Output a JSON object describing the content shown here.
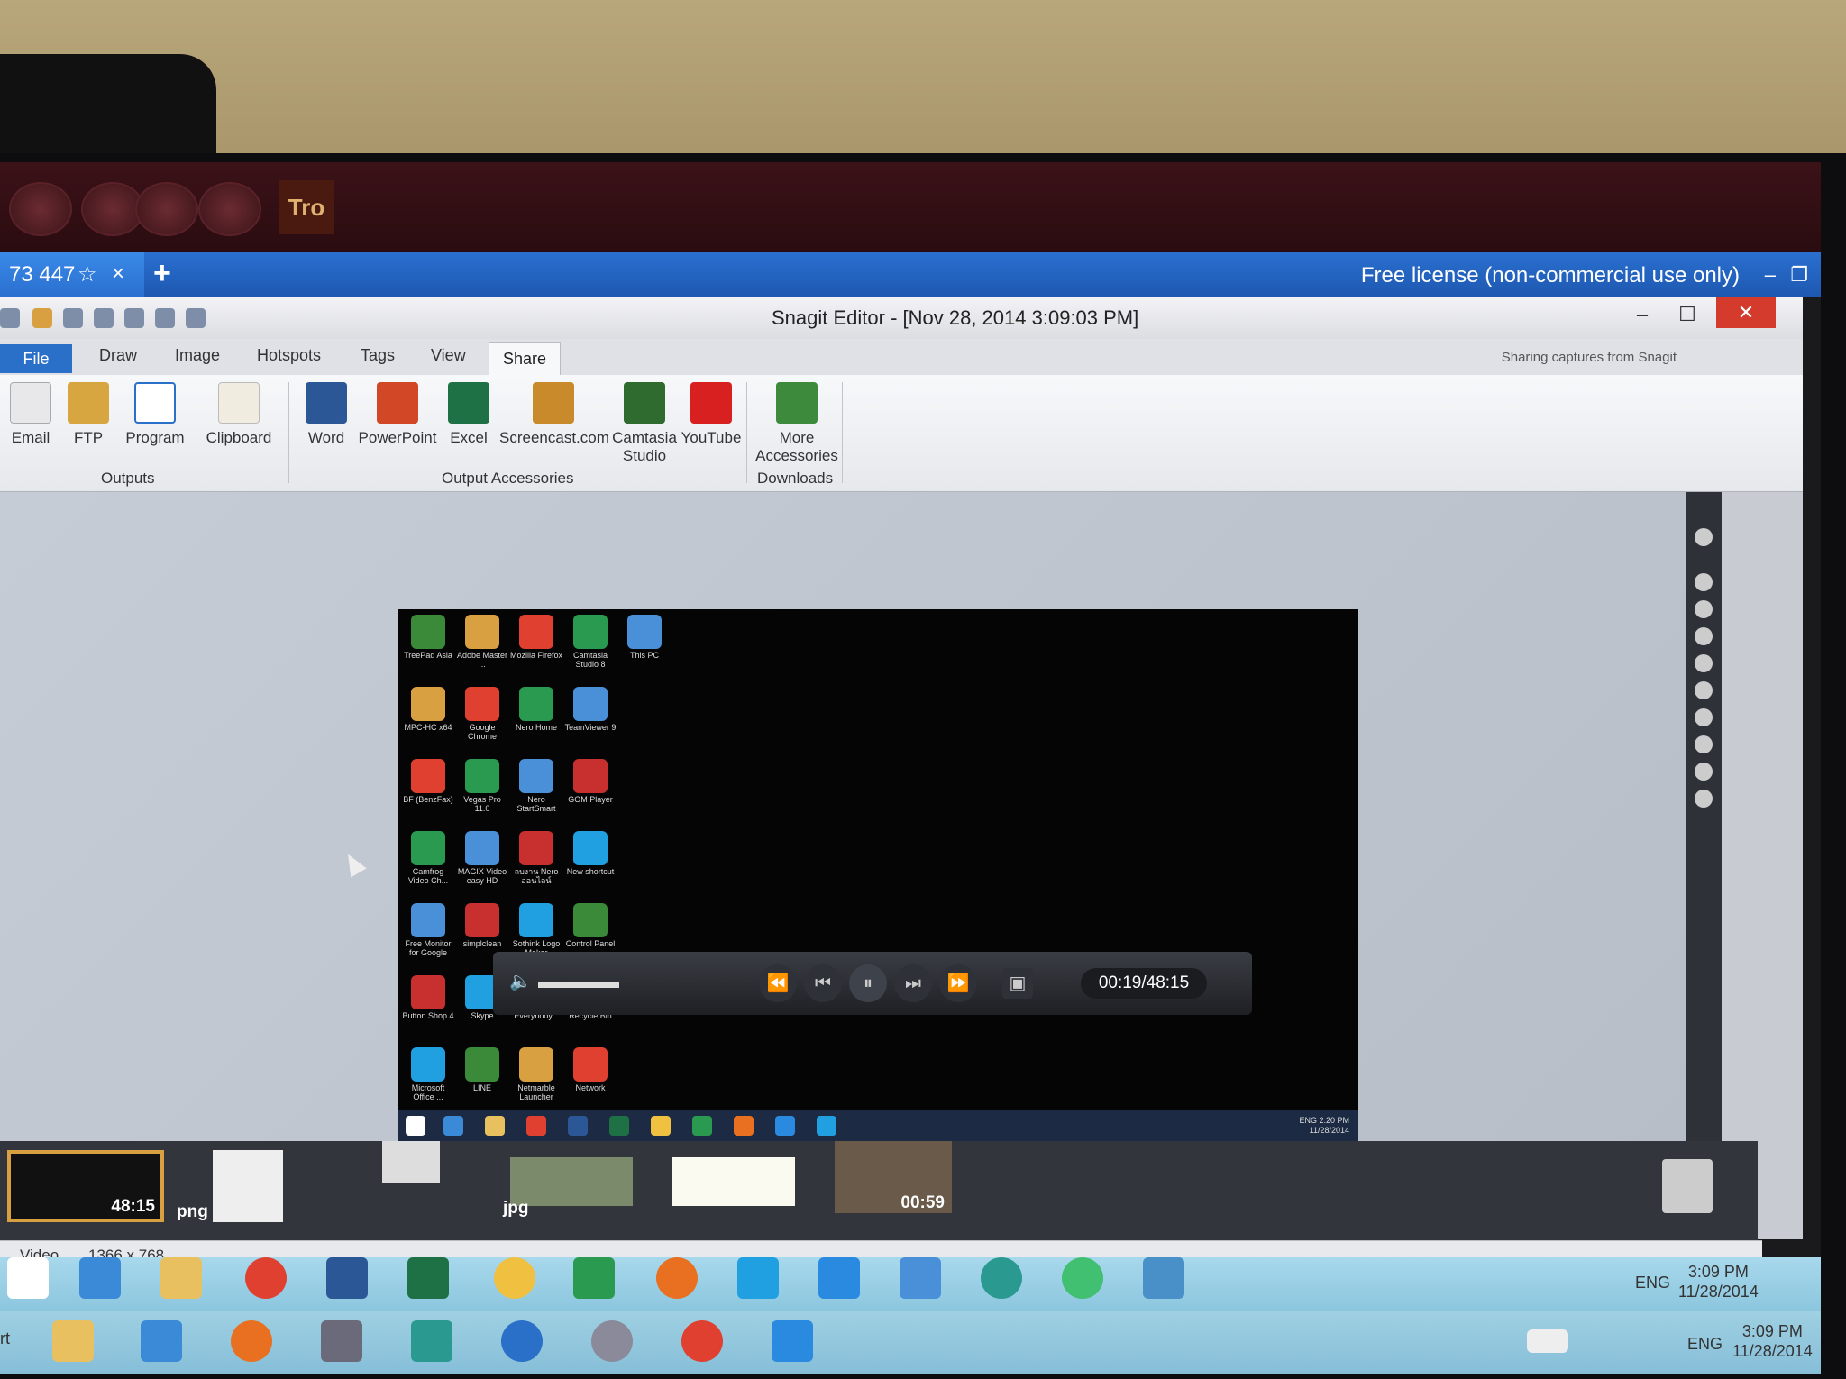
{
  "browser": {
    "tab_title": "73 447",
    "tab_star": "☆",
    "tab_close": "×",
    "tab_new": "+",
    "license_notice": "Free license (non-commercial use only)",
    "minimize": "–",
    "restore": "❐"
  },
  "app": {
    "title": "Snagit Editor - [Nov 28, 2014 3:09:03 PM]",
    "minimize": "–",
    "maximize": "☐",
    "close": "✕",
    "sharing_hint": "Sharing captures from Snagit",
    "ribbon_tabs": [
      "File",
      "Draw",
      "Image",
      "Hotspots",
      "Tags",
      "View",
      "Share"
    ],
    "active_tab": "Share"
  },
  "ribbon": {
    "outputs": {
      "label": "Outputs",
      "buttons": [
        "Email",
        "FTP",
        "Program",
        "Clipboard"
      ]
    },
    "output_accessories": {
      "label": "Output Accessories",
      "buttons": [
        "Word",
        "PowerPoint",
        "Excel",
        "Screencast.com",
        "Camtasia Studio",
        "YouTube"
      ]
    },
    "downloads": {
      "label": "Downloads",
      "buttons": [
        "More Accessories"
      ]
    }
  },
  "captured_desktop": {
    "icons": [
      [
        "TreePad Asia",
        "Adobe Master ...",
        "Mozilla Firefox",
        "Camtasia Studio 8",
        "This PC"
      ],
      [
        "MPC-HC x64",
        "Google Chrome",
        "Nero Home",
        "TeamViewer 9"
      ],
      [
        "BF (BenzFax)",
        "Vegas Pro 11.0",
        "Nero StartSmart",
        "GOM Player"
      ],
      [
        "Camfrog Video Ch...",
        "MAGIX Video easy HD",
        "ลบงาน Nero ออนไลน์",
        "New shortcut"
      ],
      [
        "Free Monitor for Google",
        "simplclean",
        "Sothink Logo Maker",
        "Control Panel"
      ],
      [
        "Button Shop 4",
        "Skype",
        "Everybody...",
        "Recycle Bin"
      ],
      [
        "Microsoft Office ...",
        "LINE",
        "Netmarble Launcher",
        "Network"
      ]
    ],
    "tray_lang": "ENG",
    "tray_time": "2:20 PM",
    "tray_date": "11/28/2014"
  },
  "player": {
    "time": "00:19/48:15"
  },
  "tray_thumbs": [
    {
      "label": "48:15",
      "kind": "video"
    },
    {
      "label": "png",
      "kind": "image"
    },
    {
      "label": "",
      "kind": "image"
    },
    {
      "label": "jpg",
      "kind": "image"
    },
    {
      "label": "",
      "kind": "image"
    },
    {
      "label": "00:59",
      "kind": "video"
    }
  ],
  "status_bar": {
    "type": "Video",
    "dimensions": "1366 x 768"
  },
  "taskbar": {
    "lang": "ENG",
    "time": "3:09 PM",
    "date": "11/28/2014",
    "lower_prefix": "rt",
    "lower_lang": "ENG",
    "lower_time": "3:09 PM",
    "lower_date": "11/28/2014"
  },
  "colors": {
    "accent_blue": "#2a6fc8",
    "close_red": "#d43b2c",
    "taskbar": "#9fd0e2"
  }
}
